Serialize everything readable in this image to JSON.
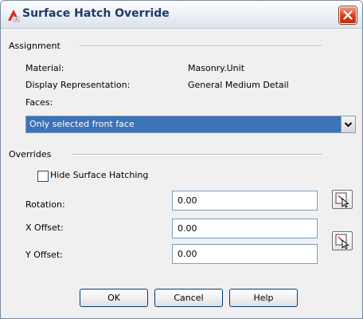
{
  "window": {
    "title": "Surface Hatch Override"
  },
  "assignment": {
    "group_label": "Assignment",
    "material_label": "Material:",
    "material_value": "Masonry.Unit",
    "display_rep_label": "Display Representation:",
    "display_rep_value": "General Medium Detail",
    "faces_label": "Faces:",
    "faces_selected": "Only selected front face"
  },
  "overrides": {
    "group_label": "Overrides",
    "hide_hatching_label": "Hide Surface Hatching",
    "hide_hatching_checked": false,
    "rotation_label": "Rotation:",
    "rotation_value": "0.00",
    "x_offset_label": "X Offset:",
    "x_offset_value": "0.00",
    "y_offset_label": "Y Offset:",
    "y_offset_value": "0.00"
  },
  "buttons": {
    "ok": "OK",
    "cancel": "Cancel",
    "help": "Help"
  },
  "icons": {
    "app": "autocad-app-icon",
    "close": "close-icon",
    "dropdown": "chevron-down-icon",
    "pick_rotation": "pick-point-icon",
    "pick_offset": "pick-point-icon"
  },
  "colors": {
    "title_text": "#1f3a6b",
    "close_button": "#d2411e",
    "selection_highlight": "#3d72b8"
  }
}
